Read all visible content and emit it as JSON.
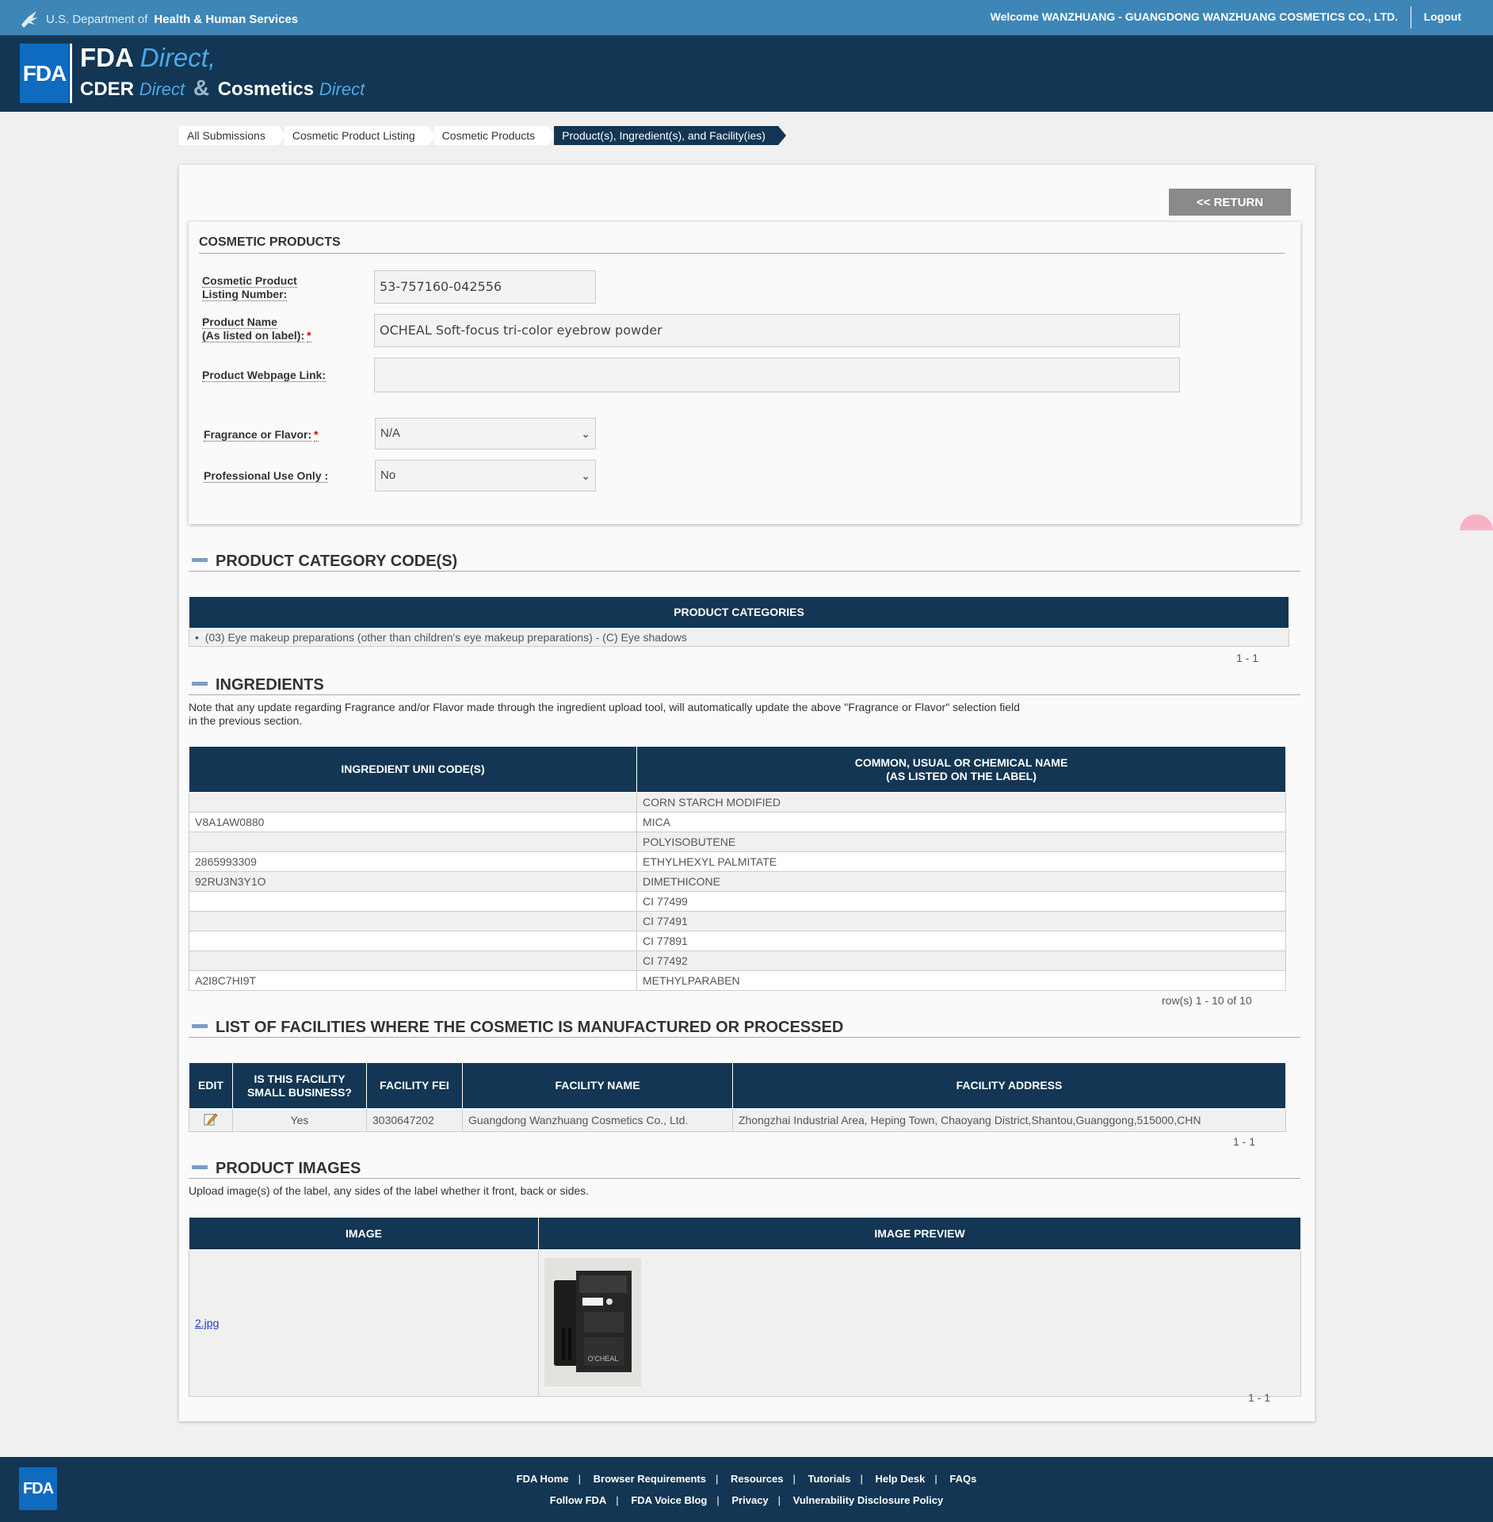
{
  "header": {
    "dept_prefix": "U.S. Department of",
    "dept_name": "Health & Human Services",
    "welcome": "Welcome WANZHUANG - GUANGDONG WANZHUANG COSMETICS CO., LTD.",
    "logout": "Logout"
  },
  "banner": {
    "logo": "FDA",
    "line1_bold": "FDA",
    "line1_italic": "Direct,",
    "line2_a": "CDER",
    "line2_a_italic": "Direct",
    "amp": "&",
    "line2_b": "Cosmetics",
    "line2_b_italic": "Direct"
  },
  "breadcrumb": [
    "All Submissions",
    "Cosmetic Product Listing",
    "Cosmetic Products",
    "Product(s), Ingredient(s), and Facility(ies)"
  ],
  "return_label": "<< RETURN",
  "form": {
    "title": "COSMETIC PRODUCTS",
    "listing_number_label_1": "Cosmetic Product",
    "listing_number_label_2": "Listing Number:",
    "listing_number": "53-757160-042556",
    "product_name_label_1": "Product Name",
    "product_name_label_2": "(As listed on label):",
    "product_name": "OCHEAL Soft-focus tri-color eyebrow powder",
    "webpage_label": "Product Webpage Link:",
    "webpage": "",
    "fragrance_label": "Fragrance or Flavor:",
    "fragrance": "N/A",
    "professional_label": "Professional Use Only :",
    "professional": "No",
    "required_mark": "*"
  },
  "categories": {
    "title": "PRODUCT CATEGORY CODE(S)",
    "header": "PRODUCT CATEGORIES",
    "items": [
      "(03) Eye makeup preparations (other than children's eye makeup preparations) - (C) Eye shadows"
    ],
    "pager": "1 - 1"
  },
  "ingredients": {
    "title": "INGREDIENTS",
    "note_1": "Note that any update regarding Fragrance and/or Flavor made through the ingredient upload tool, will automatically update the above \"Fragrance or Flavor\" selection field",
    "note_2": "in the previous section.",
    "col1": "INGREDIENT UNII CODE(S)",
    "col2_1": "COMMON, USUAL OR CHEMICAL NAME",
    "col2_2": "(AS LISTED ON THE LABEL)",
    "rows": [
      {
        "code": "",
        "name": "CORN STARCH MODIFIED"
      },
      {
        "code": "V8A1AW0880",
        "name": "MICA"
      },
      {
        "code": "",
        "name": "POLYISOBUTENE"
      },
      {
        "code": "2865993309",
        "name": "ETHYLHEXYL PALMITATE"
      },
      {
        "code": "92RU3N3Y1O",
        "name": "DIMETHICONE"
      },
      {
        "code": "",
        "name": "CI 77499"
      },
      {
        "code": "",
        "name": "CI 77491"
      },
      {
        "code": "",
        "name": "CI 77891"
      },
      {
        "code": "",
        "name": "CI 77492"
      },
      {
        "code": "A2I8C7HI9T",
        "name": "METHYLPARABEN"
      }
    ],
    "pager": "row(s) 1 - 10 of 10"
  },
  "facilities": {
    "title": "LIST OF FACILITIES WHERE THE COSMETIC IS MANUFACTURED OR PROCESSED",
    "col_edit": "EDIT",
    "col_small_1": "IS THIS FACILITY",
    "col_small_2": "SMALL BUSINESS?",
    "col_fei": "FACILITY FEI",
    "col_name": "FACILITY NAME",
    "col_address": "FACILITY ADDRESS",
    "rows": [
      {
        "small_business": "Yes",
        "fei": "3030647202",
        "name": "Guangdong Wanzhuang Cosmetics Co., Ltd.",
        "address": "Zhongzhai Industrial Area, Heping Town, Chaoyang District,Shantou,Guanggong,515000,CHN"
      }
    ],
    "pager": "1 - 1"
  },
  "images": {
    "title": "PRODUCT IMAGES",
    "note": "Upload image(s) of the label, any sides of the label whether it front, back or sides.",
    "col_image": "IMAGE",
    "col_preview": "IMAGE PREVIEW",
    "file": "2.jpg",
    "preview_brand": "O'CHEAL",
    "pager": "1 - 1"
  },
  "footer": {
    "logo": "FDA",
    "row1": [
      "FDA Home",
      "Browser Requirements",
      "Resources",
      "Tutorials",
      "Help Desk",
      "FAQs"
    ],
    "row2": [
      "Follow FDA",
      "FDA Voice Blog",
      "Privacy",
      "Vulnerability Disclosure Policy"
    ]
  }
}
